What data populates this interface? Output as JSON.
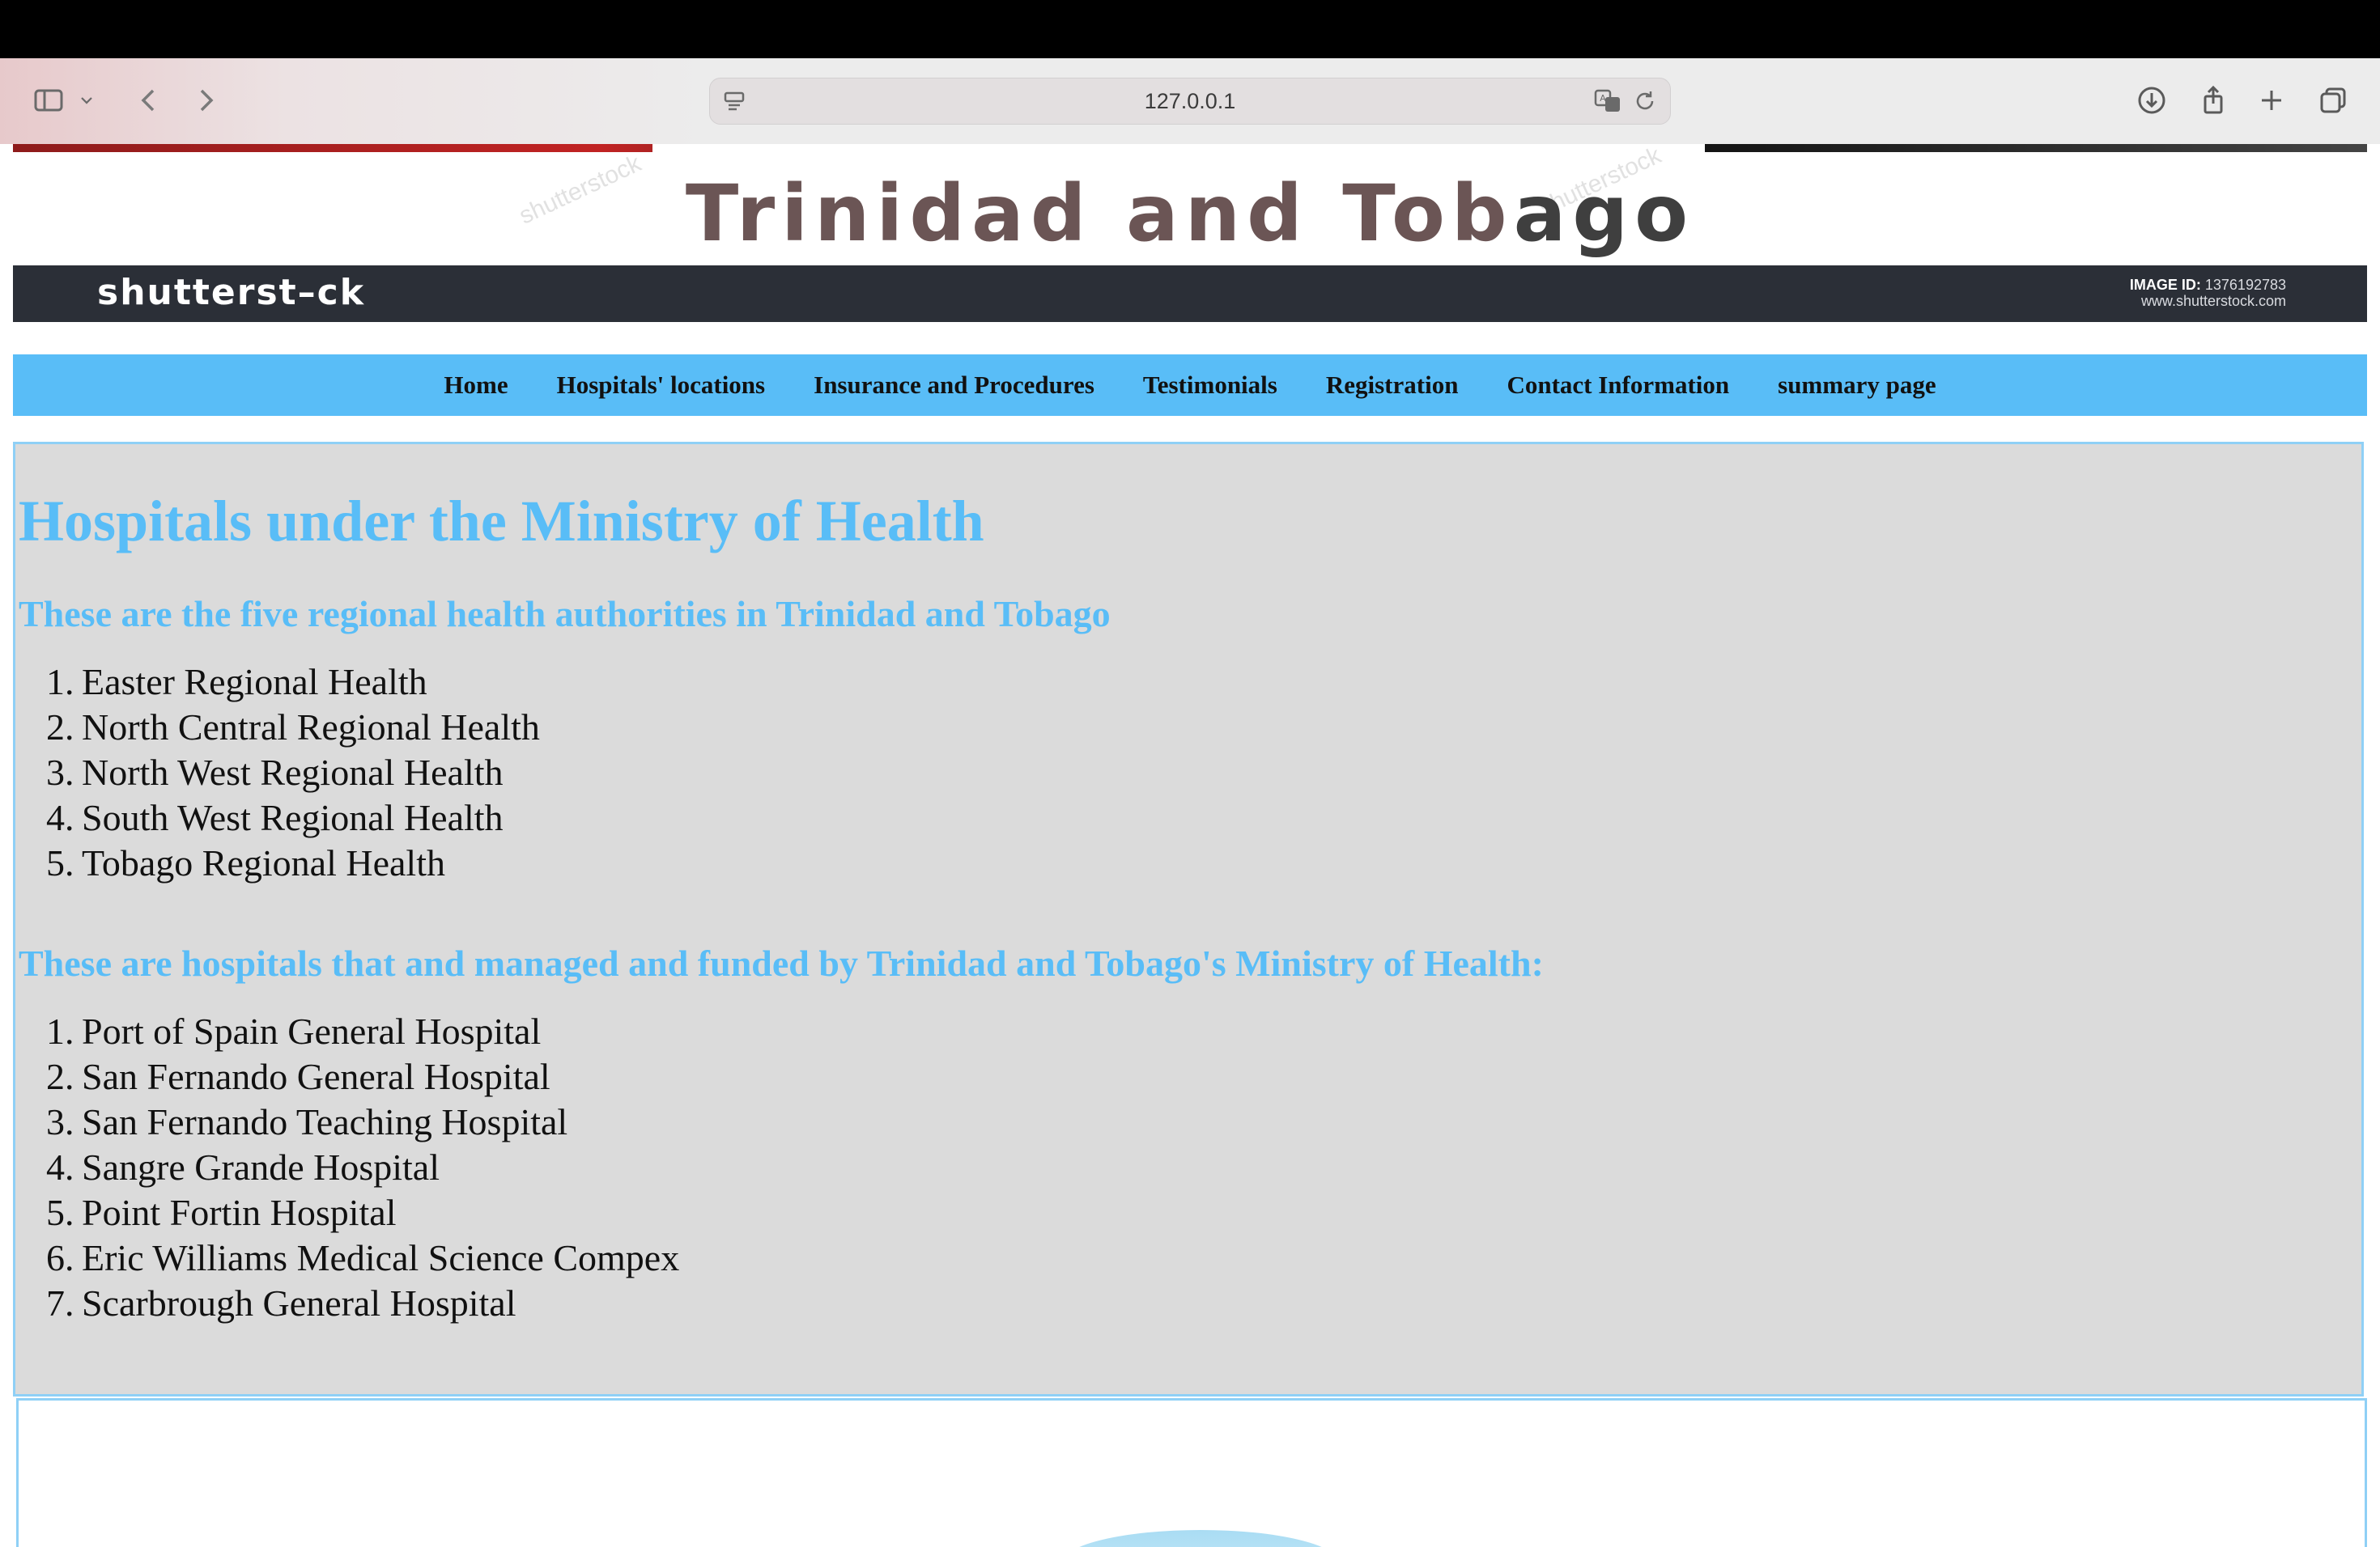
{
  "browser": {
    "url": "127.0.0.1"
  },
  "banner": {
    "title_part1": "Trinidad and Tob",
    "title_part2": "ago",
    "logo": "shutterst–ck",
    "watermark": "shutterstock",
    "image_id_label": "IMAGE ID:",
    "image_id_value": "1376192783",
    "site": "www.shutterstock.com"
  },
  "nav": {
    "items": [
      "Home",
      "Hospitals' locations",
      "Insurance and Procedures",
      "Testimonials",
      "Registration",
      "Contact Information",
      "summary page"
    ]
  },
  "content": {
    "heading": "Hospitals under the Ministry of Health",
    "subheading1": "These are the five regional health authorities in Trinidad and Tobago",
    "authorities": [
      "Easter Regional Health",
      "North Central Regional Health",
      "North West Regional Health",
      "South West Regional Health",
      "Tobago Regional Health"
    ],
    "subheading2": "These are hospitals that and managed and funded by Trinidad and Tobago's Ministry of Health:",
    "hospitals": [
      "Port of Spain General Hospital",
      "San Fernando General Hospital",
      "San Fernando Teaching Hospital",
      "Sangre Grande Hospital",
      "Point Fortin Hospital",
      "Eric Williams Medical Science Compex",
      "Scarbrough General Hospital"
    ]
  }
}
